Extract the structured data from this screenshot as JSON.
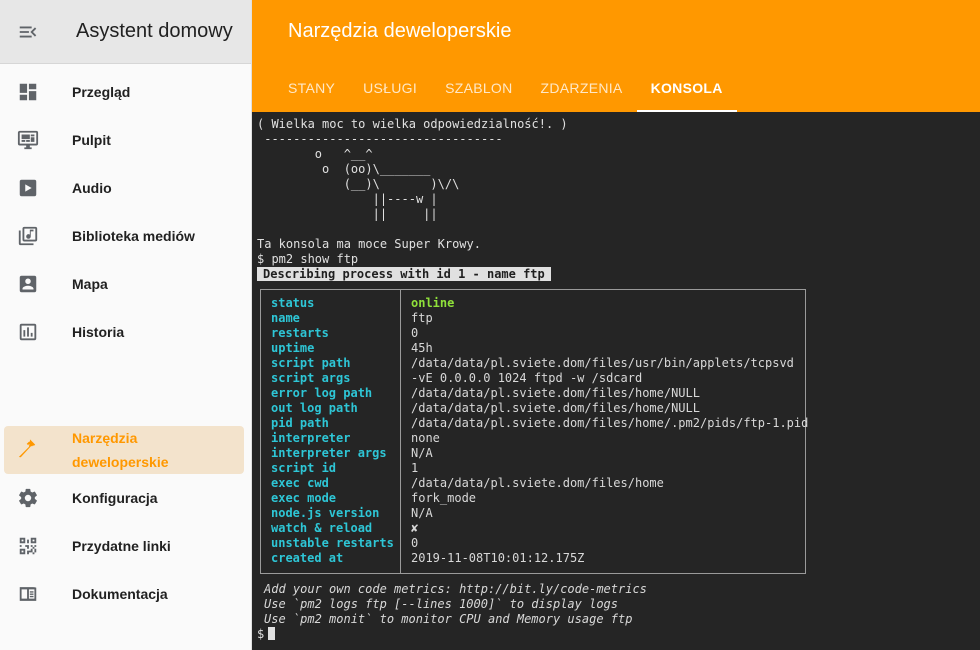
{
  "sidebar": {
    "title": "Asystent domowy",
    "items": [
      {
        "label": "Przegląd",
        "icon": "dashboard-icon"
      },
      {
        "label": "Pulpit",
        "icon": "monitor-dashboard-icon"
      },
      {
        "label": "Audio",
        "icon": "play-box-icon"
      },
      {
        "label": "Biblioteka mediów",
        "icon": "library-music-icon"
      },
      {
        "label": "Mapa",
        "icon": "account-box-icon"
      },
      {
        "label": "Historia",
        "icon": "chart-box-icon"
      }
    ],
    "bottom": [
      {
        "label": "Narzędzia deweloperskie",
        "icon": "hammer-icon",
        "active": true
      },
      {
        "label": "Konfiguracja",
        "icon": "cog-icon"
      },
      {
        "label": "Przydatne linki",
        "icon": "qrcode-icon"
      },
      {
        "label": "Dokumentacja",
        "icon": "book-icon"
      }
    ],
    "accent_color": "#ff9800"
  },
  "header": {
    "title": "Narzędzia deweloperskie",
    "tabs": [
      "STANY",
      "USŁUGI",
      "SZABLON",
      "ZDARZENIA",
      "KONSOLA"
    ],
    "active_tab": "KONSOLA",
    "background_color": "#ff9800"
  },
  "console": {
    "cowsay": [
      "( Wielka moc to wielka odpowiedzialność!. )",
      " ---------------------------------",
      "        o   ^__^",
      "         o  (oo)\\_______",
      "            (__)\\       )\\/\\",
      "                ||----w |",
      "                ||     ||"
    ],
    "motd": "Ta konsola ma moce Super Krowy.",
    "command": "$ pm2 show ftp",
    "describing": "Describing process with id 1 - name ftp",
    "table": [
      {
        "key": "status",
        "value": "online"
      },
      {
        "key": "name",
        "value": "ftp"
      },
      {
        "key": "restarts",
        "value": "0"
      },
      {
        "key": "uptime",
        "value": "45h"
      },
      {
        "key": "script path",
        "value": "/data/data/pl.sviete.dom/files/usr/bin/applets/tcpsvd"
      },
      {
        "key": "script args",
        "value": "-vE 0.0.0.0 1024 ftpd -w /sdcard"
      },
      {
        "key": "error log path",
        "value": "/data/data/pl.sviete.dom/files/home/NULL"
      },
      {
        "key": "out log path",
        "value": "/data/data/pl.sviete.dom/files/home/NULL"
      },
      {
        "key": "pid path",
        "value": "/data/data/pl.sviete.dom/files/home/.pm2/pids/ftp-1.pid"
      },
      {
        "key": "interpreter",
        "value": "none"
      },
      {
        "key": "interpreter args",
        "value": "N/A"
      },
      {
        "key": "script id",
        "value": "1"
      },
      {
        "key": "exec cwd",
        "value": "/data/data/pl.sviete.dom/files/home"
      },
      {
        "key": "exec mode",
        "value": "fork_mode"
      },
      {
        "key": "node.js version",
        "value": "N/A"
      },
      {
        "key": "watch & reload",
        "value": "✘"
      },
      {
        "key": "unstable restarts",
        "value": "0"
      },
      {
        "key": "created at",
        "value": "2019-11-08T10:01:12.175Z"
      }
    ],
    "footer": [
      "Add your own code metrics: http://bit.ly/code-metrics",
      "Use `pm2 logs ftp [--lines 1000]` to display logs",
      "Use `pm2 monit` to monitor CPU and Memory usage ftp"
    ],
    "prompt": "$",
    "key_color": "#2ec6d6",
    "online_color": "#8fe03a",
    "background_color": "#252525"
  }
}
